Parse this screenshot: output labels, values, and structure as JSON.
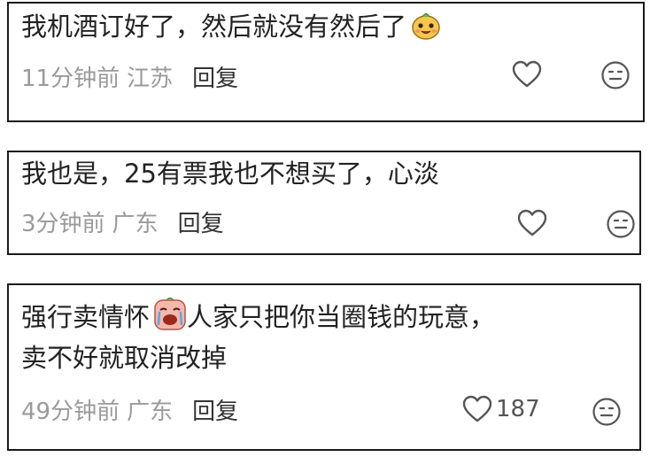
{
  "comments": [
    {
      "text": "我机酒订好了，然后就没有然后了",
      "emoji": "smiling-face-sticker",
      "time": "11分钟前",
      "location": "江苏",
      "reply_label": "回复",
      "likes": ""
    },
    {
      "text": "我也是，25有票我也不想买了，心淡",
      "time": "3分钟前",
      "location": "广东",
      "reply_label": "回复",
      "likes": ""
    },
    {
      "text_part1": "强行卖情怀",
      "emoji": "crying-face-sticker",
      "text_part2": "人家只把你当圈钱的玩意，",
      "text_line2": "卖不好就取消改掉",
      "time": "49分钟前",
      "location": "广东",
      "reply_label": "回复",
      "likes": "187"
    }
  ],
  "colors": {
    "text": "#222222",
    "meta": "#9a9a9a",
    "icon": "#555555",
    "border": "#1a1a1a"
  },
  "icons": [
    "heart-outline-icon",
    "neutral-face-icon"
  ]
}
